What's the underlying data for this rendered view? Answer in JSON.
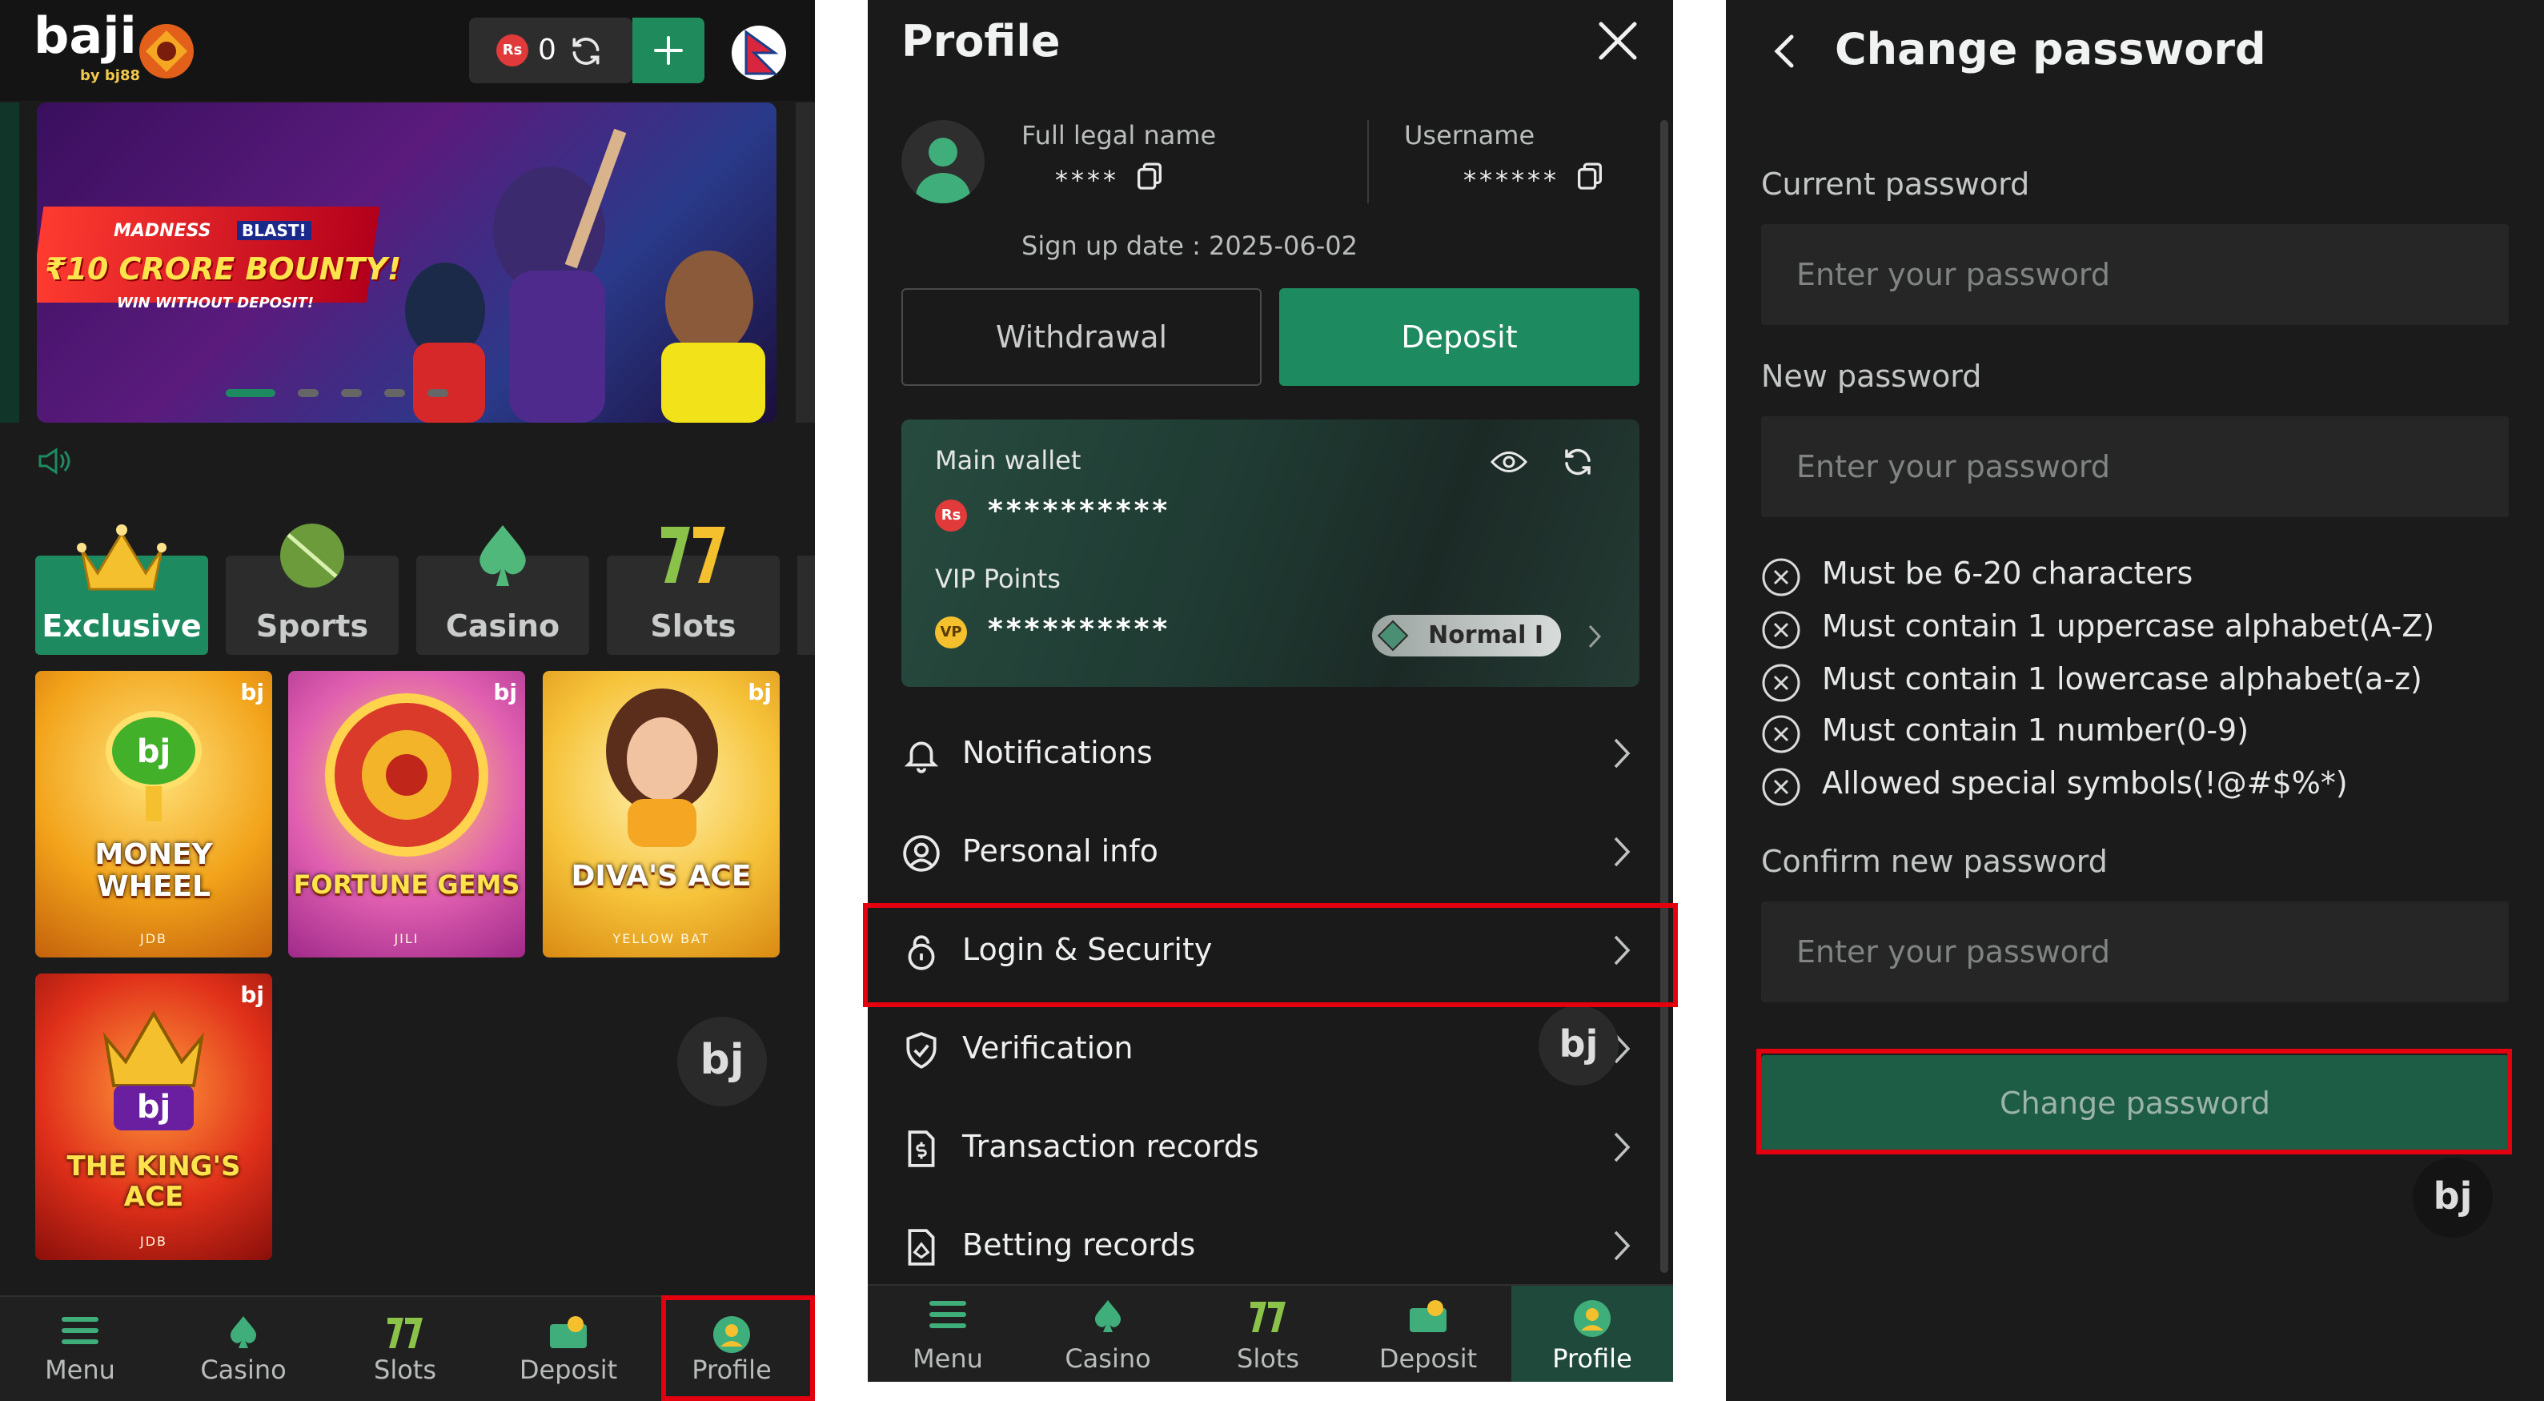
{
  "home": {
    "brand": {
      "logo_text": "baji",
      "logo_sub": "by bj88"
    },
    "balance": {
      "currency_symbol": "Rs",
      "amount": "0"
    },
    "banner": {
      "tag": "MADNESS",
      "tag2": "BLAST!",
      "headline": "₹10 CRORE BOUNTY!",
      "subline": "WIN WITHOUT DEPOSIT!"
    },
    "categories": [
      {
        "label": "Exclusive",
        "icon": "crown-icon",
        "active": true
      },
      {
        "label": "Sports",
        "icon": "cricket-ball-icon",
        "active": false
      },
      {
        "label": "Casino",
        "icon": "spade-icon",
        "active": false
      },
      {
        "label": "Slots",
        "icon": "lucky-seven-icon",
        "active": false
      }
    ],
    "games": [
      {
        "title": "MONEY WHEEL",
        "provider": "JDB"
      },
      {
        "title": "FORTUNE GEMS",
        "provider": "JILI"
      },
      {
        "title": "DIVA'S ACE",
        "provider": "YELLOW BAT"
      },
      {
        "title": "THE KING'S ACE",
        "provider": "JDB"
      }
    ],
    "fab_text": "bj",
    "nav": [
      {
        "label": "Menu",
        "icon": "menu-icon"
      },
      {
        "label": "Casino",
        "icon": "casino-icon"
      },
      {
        "label": "Slots",
        "icon": "slots-icon"
      },
      {
        "label": "Deposit",
        "icon": "deposit-icon"
      },
      {
        "label": "Profile",
        "icon": "profile-icon"
      }
    ]
  },
  "profile": {
    "title": "Profile",
    "full_name_label": "Full legal name",
    "full_name_value": "****",
    "username_label": "Username",
    "username_value": "******",
    "signup": "Sign up date : 2025-06-02",
    "withdraw_label": "Withdrawal",
    "deposit_label": "Deposit",
    "wallet": {
      "main_label": "Main wallet",
      "main_value": "**********",
      "currency_badge": "Rs",
      "vip_label": "VIP Points",
      "vip_value": "**********",
      "vip_badge": "VP",
      "tier": "Normal I"
    },
    "menu": [
      {
        "label": "Notifications",
        "icon": "bell-icon"
      },
      {
        "label": "Personal info",
        "icon": "user-circle-icon"
      },
      {
        "label": "Login & Security",
        "icon": "lock-icon"
      },
      {
        "label": "Verification",
        "icon": "shield-check-icon"
      },
      {
        "label": "Transaction records",
        "icon": "dollar-doc-icon"
      },
      {
        "label": "Betting records",
        "icon": "bet-doc-icon"
      }
    ],
    "fab_text": "bj",
    "nav": [
      {
        "label": "Menu"
      },
      {
        "label": "Casino"
      },
      {
        "label": "Slots"
      },
      {
        "label": "Deposit"
      },
      {
        "label": "Profile"
      }
    ]
  },
  "change_password": {
    "title": "Change password",
    "current_label": "Current password",
    "new_label": "New password",
    "confirm_label": "Confirm new password",
    "placeholder": "Enter your password",
    "rules": [
      "Must be 6-20 characters",
      "Must contain 1 uppercase alphabet(A-Z)",
      "Must contain 1 lowercase alphabet(a-z)",
      "Must contain 1 number(0-9)",
      "Allowed special symbols(!@#$%*)"
    ],
    "button_label": "Change password",
    "fab_text": "bj"
  },
  "colors": {
    "accent_green": "#1d8a5f",
    "highlight_red": "#e3000f",
    "background": "#1b1b1b"
  }
}
